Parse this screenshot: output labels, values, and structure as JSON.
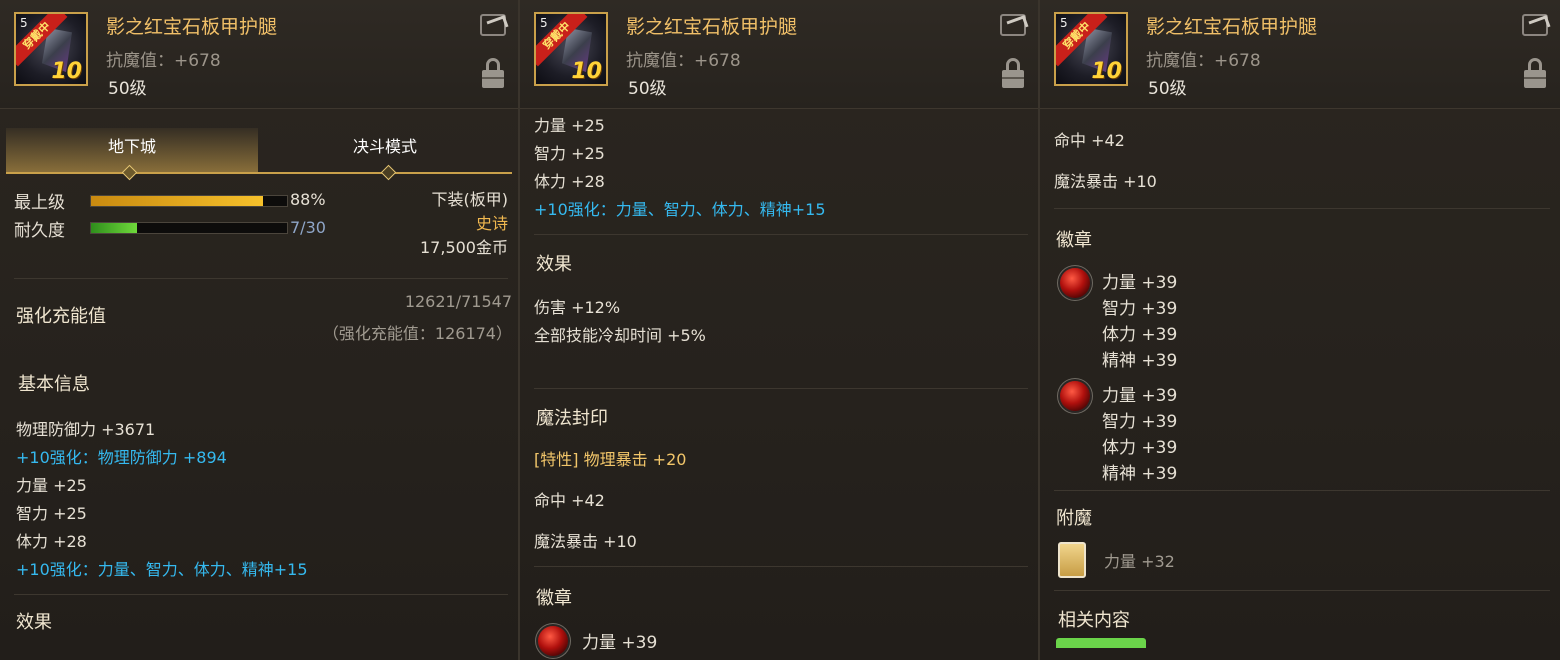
{
  "item": {
    "name": "影之红宝石板甲护腿",
    "resist": "抗魔值：+678",
    "level": "50级",
    "icon_level": "5",
    "icon_ribbon": "穿戴中",
    "icon_plus": "10",
    "share_icon": "share-icon",
    "lock_icon": "lock-icon"
  },
  "panel1": {
    "tabs": [
      "地下城",
      "决斗模式"
    ],
    "max_level_label": "最上级",
    "max_level_value": "88%",
    "max_level_fraction": 0.88,
    "durability_label": "耐久度",
    "durability_value": "7/30",
    "durability_fraction": 0.233,
    "slot": "下装(板甲)",
    "rarity": "史诗",
    "price": "17,500金币",
    "charge_label": "强化充能值",
    "charge_value": "12621/71547",
    "charge_sub": "（强化充能值：126174）",
    "basic_info_title": "基本信息",
    "stats": [
      {
        "text": "物理防御力 +3671",
        "style": "normal"
      },
      {
        "text": "+10强化：物理防御力 +894",
        "style": "cyan"
      },
      {
        "text": "力量 +25",
        "style": "normal"
      },
      {
        "text": "智力 +25",
        "style": "normal"
      },
      {
        "text": "体力 +28",
        "style": "normal"
      },
      {
        "text": "+10强化：力量、智力、体力、精神+15",
        "style": "cyan"
      }
    ],
    "effect_title": "效果"
  },
  "panel2": {
    "stats": [
      {
        "text": "力量 +25",
        "style": "normal"
      },
      {
        "text": "智力 +25",
        "style": "normal"
      },
      {
        "text": "体力 +28",
        "style": "normal"
      },
      {
        "text": "+10强化：力量、智力、体力、精神+15",
        "style": "cyan"
      }
    ],
    "effect_title": "效果",
    "effects": [
      "伤害 +12%",
      "全部技能冷却时间 +5%"
    ],
    "seal_title": "魔法封印",
    "seal_trait": "[特性] 物理暴击 +20",
    "seal_hit": "命中 +42",
    "seal_crit": "魔法暴击 +10",
    "emblem_title": "徽章",
    "emblem_partial": "力量 +39"
  },
  "panel3": {
    "hit": "命中 +42",
    "magic_crit": "魔法暴击 +10",
    "emblem_title": "徽章",
    "emblems": [
      [
        "力量 +39",
        "智力 +39",
        "体力 +39",
        "精神 +39"
      ],
      [
        "力量 +39",
        "智力 +39",
        "体力 +39",
        "精神 +39"
      ]
    ],
    "enchant_title": "附魔",
    "enchant_value": "力量 +32",
    "related_title": "相关内容"
  }
}
